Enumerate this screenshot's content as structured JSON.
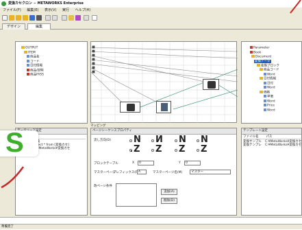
{
  "app": {
    "title": "変換カセクロン − METAWORKS Enterprise",
    "brand_color": "#3c9a3c",
    "accent_color": "#1f5fbf"
  },
  "menu": [
    "ファイル(F)",
    "編集(E)",
    "表示(V)",
    "実行",
    "ヘルプ(H)"
  ],
  "toolbar_icons": [
    "new-icon",
    "open-icon",
    "save-icon",
    "save-all-icon",
    "export-icon",
    "print-icon",
    "undo-icon",
    "redo-icon",
    "cut-icon",
    "copy-icon",
    "paste-icon",
    "grid-icon",
    "run-icon"
  ],
  "tabs": [
    "デザイン",
    "編集"
  ],
  "left_tree": [
    {
      "label": "OUTPUT",
      "icon": "folder"
    },
    {
      "label": "ITEM",
      "icon": "folder"
    },
    {
      "label": "商品名",
      "icon": "doc"
    },
    {
      "label": "コード",
      "icon": "doc"
    },
    {
      "label": "日付情報",
      "icon": "doc"
    },
    {
      "label": "商品/説明",
      "icon": "red"
    },
    {
      "label": "商品FASS",
      "icon": "red"
    }
  ],
  "right_tree": [
    {
      "label": "Parameter",
      "icon": "red"
    },
    {
      "label": "Book",
      "icon": "red"
    },
    {
      "label": "Document",
      "icon": "folder"
    },
    {
      "label": "変換データ",
      "icon": "selected"
    },
    {
      "label": "変換ブロック",
      "icon": "folder"
    },
    {
      "label": "商品コード",
      "icon": "folder"
    },
    {
      "label": "Word",
      "icon": "doc"
    },
    {
      "label": "日付情報",
      "icon": "folder"
    },
    {
      "label": "日付",
      "icon": "doc"
    },
    {
      "label": "Word",
      "icon": "doc"
    },
    {
      "label": "価格",
      "icon": "folder"
    },
    {
      "label": "単価",
      "icon": "doc"
    },
    {
      "label": "Word",
      "icon": "doc"
    },
    {
      "label": "Price",
      "icon": "doc"
    },
    {
      "label": "Word",
      "icon": "doc"
    }
  ],
  "canvas_tab": "マッピング",
  "bottom_left": {
    "tab": "データソース設定",
    "headers": [
      "項目",
      "値"
    ],
    "rows": [
      [
        "名前",
        "変換"
      ],
      [
        "",
        "select * from [変換カセ]"
      ],
      [
        "",
        "C:¥MetaWorks¥変換カセ"
      ]
    ]
  },
  "bottom_center": {
    "tab": "ページシーケンスプロパティ",
    "direction_label": "流し方向(D)",
    "glyphs_top": [
      "N",
      "И",
      "Ν",
      "N"
    ],
    "glyphs_bottom": [
      "Z",
      "Z",
      "Z",
      "Z"
    ],
    "selected_index": 0,
    "block_count_label": "ブロックテーブル",
    "x_label": "X",
    "x_value": "0",
    "y_label": "Y",
    "y_value": "0",
    "master_page_label": "マスターページ",
    "prefix_label": "プレフィックス(P)",
    "prefix_value": "A",
    "master_page_name_label": "マスターページ名(M)",
    "master_page_name_value": "マスター",
    "break_label": "改ページ条件",
    "add_button": "追加(A)",
    "delete_button": "削除(D)"
  },
  "bottom_right": {
    "tab": "テンプレート設定",
    "headers": [
      "ファイル名",
      "パス"
    ],
    "rows": [
      [
        "変換サンプル",
        "C:¥MetaWorks¥変換カセ"
      ],
      [
        "変換テンプレ",
        "C:¥MetaWorks¥変換カセ"
      ]
    ]
  },
  "status": "準備完了",
  "logo_fragment": "S"
}
